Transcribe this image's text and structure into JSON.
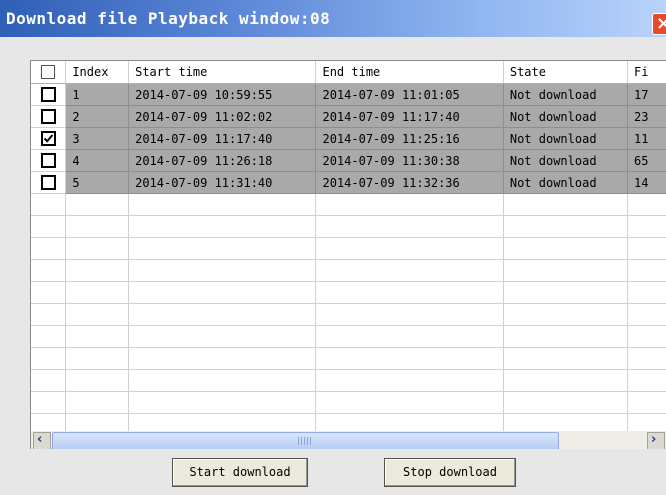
{
  "window": {
    "title": "Download file Playback window:08"
  },
  "table": {
    "columns": [
      "Index",
      "Start time",
      "End time",
      "State",
      "Fi"
    ],
    "rows": [
      {
        "checked": false,
        "index": "1",
        "start": "2014-07-09 10:59:55",
        "end": "2014-07-09 11:01:05",
        "state": "Not download",
        "file": "17"
      },
      {
        "checked": false,
        "index": "2",
        "start": "2014-07-09 11:02:02",
        "end": "2014-07-09 11:17:40",
        "state": "Not download",
        "file": "23"
      },
      {
        "checked": true,
        "index": "3",
        "start": "2014-07-09 11:17:40",
        "end": "2014-07-09 11:25:16",
        "state": "Not download",
        "file": "11"
      },
      {
        "checked": false,
        "index": "4",
        "start": "2014-07-09 11:26:18",
        "end": "2014-07-09 11:30:38",
        "state": "Not download",
        "file": "65"
      },
      {
        "checked": false,
        "index": "5",
        "start": "2014-07-09 11:31:40",
        "end": "2014-07-09 11:32:36",
        "state": "Not download",
        "file": "14"
      }
    ]
  },
  "buttons": {
    "start": "Start download",
    "stop": "Stop download"
  },
  "colors": {
    "title_bar_start": "#2f5fb7",
    "title_bar_end": "#b9d3fb",
    "selected_row": "#a9a9a9"
  }
}
